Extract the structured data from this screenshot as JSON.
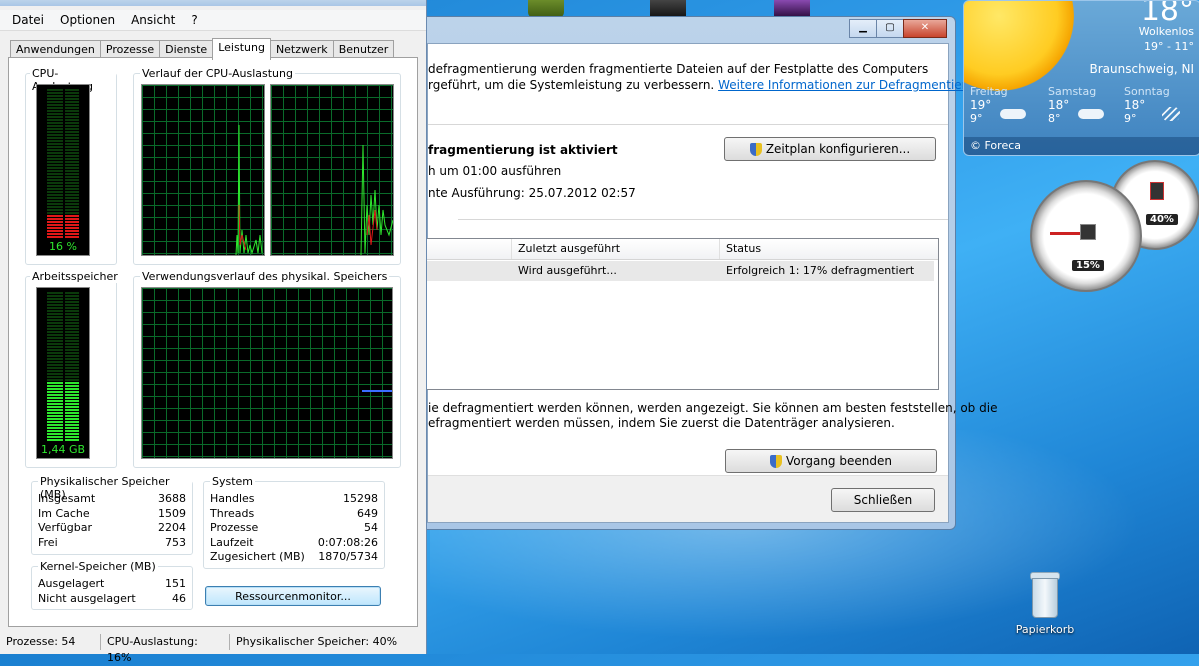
{
  "taskmanager": {
    "menu": [
      "Datei",
      "Optionen",
      "Ansicht",
      "?"
    ],
    "tabs": [
      "Anwendungen",
      "Prozesse",
      "Dienste",
      "Leistung",
      "Netzwerk",
      "Benutzer"
    ],
    "active_tab": "Leistung",
    "cpu_usage_title": "CPU-Auslastung",
    "cpu_usage_value": "16 %",
    "cpu_usage_percent": 16,
    "cpu_history_title": "Verlauf der CPU-Auslastung",
    "mem_title": "Arbeitsspeicher",
    "mem_value": "1,44 GB",
    "mem_fill_percent": 40,
    "mem_history_title": "Verwendungsverlauf des physikal. Speichers",
    "physical": {
      "title": "Physikalischer Speicher (MB)",
      "rows": [
        {
          "label": "Insgesamt",
          "value": "3688"
        },
        {
          "label": "Im Cache",
          "value": "1509"
        },
        {
          "label": "Verfügbar",
          "value": "2204"
        },
        {
          "label": "Frei",
          "value": "753"
        }
      ]
    },
    "system": {
      "title": "System",
      "rows": [
        {
          "label": "Handles",
          "value": "15298"
        },
        {
          "label": "Threads",
          "value": "649"
        },
        {
          "label": "Prozesse",
          "value": "54"
        },
        {
          "label": "Laufzeit",
          "value": "0:07:08:26"
        },
        {
          "label": "Zugesichert (MB)",
          "value": "1870/5734"
        }
      ]
    },
    "kernel": {
      "title": "Kernel-Speicher (MB)",
      "rows": [
        {
          "label": "Ausgelagert",
          "value": "151"
        },
        {
          "label": "Nicht ausgelagert",
          "value": "46"
        }
      ]
    },
    "resource_monitor_button": "Ressourcenmonitor...",
    "status": {
      "processes": "Prozesse: 54",
      "cpu": "CPU-Auslastung: 16%",
      "memory": "Physikalischer Speicher: 40%"
    }
  },
  "defrag": {
    "intro_line1": "defragmentierung werden fragmentierte Dateien auf der Festplatte des Computers",
    "intro_line2": "rgeführt, um die Systemleistung zu verbessern.",
    "intro_link": "Weitere Informationen zur Defragmentierung",
    "schedule_title": "fragmentierung ist aktiviert",
    "schedule_line1": "h um 01:00 ausführen",
    "schedule_line2": "nte Ausführung: 25.07.2012 02:57",
    "schedule_button": "Zeitplan konfigurieren...",
    "columns": [
      "Zuletzt ausgeführt",
      "Status"
    ],
    "row": {
      "last_run": "Wird ausgeführt...",
      "status": "Erfolgreich 1: 17% defragmentiert"
    },
    "hint_line1": "ie defragmentiert werden können, werden angezeigt. Sie können am besten feststellen, ob die",
    "hint_line2": "efragmentiert werden müssen, indem Sie zuerst die Datenträger analysieren.",
    "stop_button": "Vorgang beenden",
    "close_button": "Schließen",
    "window_buttons": {
      "minimize": "▁",
      "maximize": "▢",
      "close": "✕"
    }
  },
  "weather": {
    "temperature": "18°",
    "condition": "Wolkenlos",
    "range": "19° - 11°",
    "city": "Braunschweig, NI",
    "forecast": [
      {
        "day": "Freitag",
        "high": "19°",
        "low": "9°"
      },
      {
        "day": "Samstag",
        "high": "18°",
        "low": "8°"
      },
      {
        "day": "Sonntag",
        "high": "18°",
        "low": "9°"
      }
    ],
    "provider": "© Foreca"
  },
  "meter_gadget": {
    "cpu": "15%",
    "memory": "40%"
  },
  "desktop": {
    "recycle_bin": "Papierkorb"
  },
  "colors": {
    "graph_green": "#2ee82e",
    "graph_grid": "#0a6a2a",
    "meter_red": "#e01818",
    "link": "#0066cc"
  }
}
